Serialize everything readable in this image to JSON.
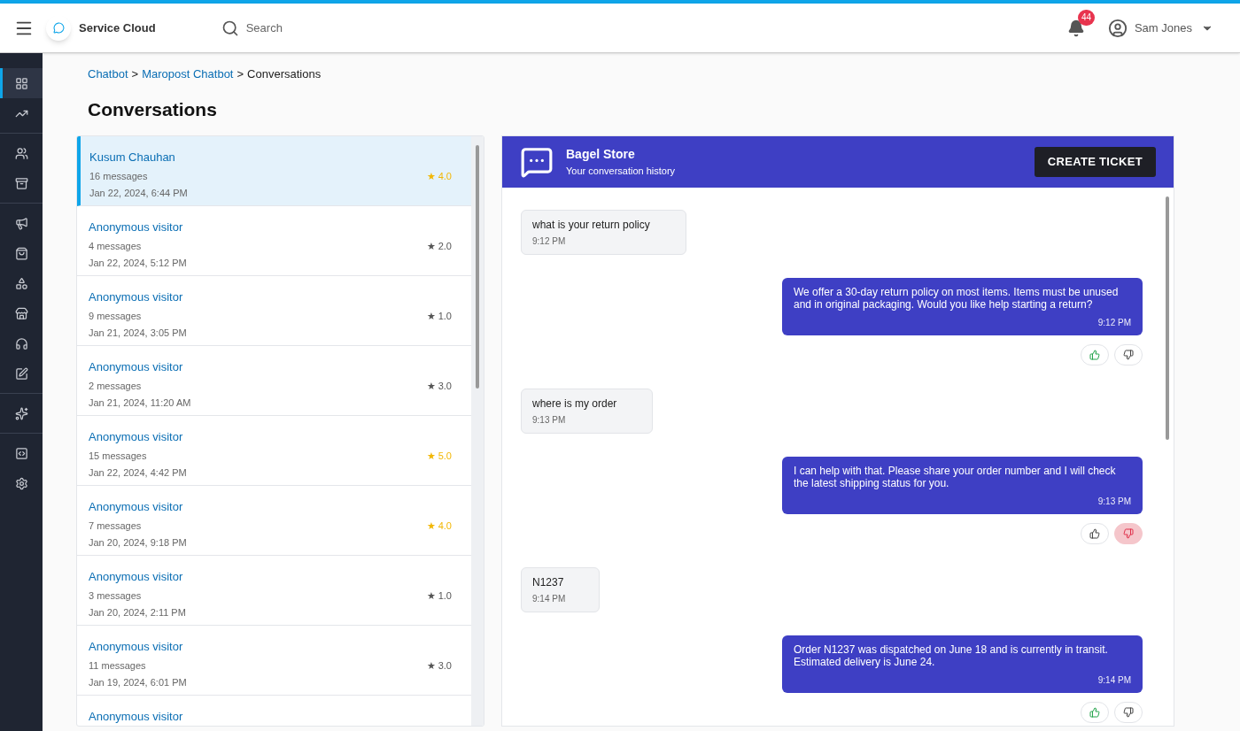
{
  "topbar": {
    "app_name": "Service Cloud",
    "search": {
      "placeholder": "Search"
    },
    "notifications": {
      "count": "44"
    },
    "user": {
      "name": "Sam Jones"
    }
  },
  "sidebar": {
    "groups": [
      [
        {
          "selected": true
        },
        {
          "selected": false
        }
      ],
      [
        {
          "selected": false
        },
        {
          "selected": false
        }
      ],
      [
        {
          "selected": false
        },
        {
          "selected": false
        },
        {
          "selected": false
        },
        {
          "selected": false
        },
        {
          "selected": false
        },
        {
          "selected": false
        }
      ],
      [
        {
          "selected": false
        }
      ],
      [
        {
          "selected": false
        },
        {
          "selected": false
        }
      ]
    ]
  },
  "breadcrumb": {
    "links": [
      "Chatbot",
      "Maropost Chatbot"
    ],
    "separators": [
      ">",
      ">"
    ],
    "current": "Conversations"
  },
  "page_title": "Conversations",
  "conversations": [
    {
      "name": "Kusum Chauhan",
      "messages": "16 messages",
      "date": "Jan 22, 2024, 6:44 PM",
      "rating": "★ 4.0",
      "color": "#f2b705",
      "selected": true
    },
    {
      "name": "Anonymous visitor",
      "messages": "4 messages",
      "date": "Jan 22, 2024, 5:12 PM",
      "rating": "★ 2.0",
      "color": "#555555",
      "selected": false
    },
    {
      "name": "Anonymous visitor",
      "messages": "9 messages",
      "date": "Jan 21, 2024, 3:05 PM",
      "rating": "★ 1.0",
      "color": "#555555",
      "selected": false
    },
    {
      "name": "Anonymous visitor",
      "messages": "2 messages",
      "date": "Jan 21, 2024, 11:20 AM",
      "rating": "★ 3.0",
      "color": "#555555",
      "selected": false
    },
    {
      "name": "Anonymous visitor",
      "messages": "15 messages",
      "date": "Jan 22, 2024, 4:42 PM",
      "rating": "★ 5.0",
      "color": "#f2b705",
      "selected": false
    },
    {
      "name": "Anonymous visitor",
      "messages": "7 messages",
      "date": "Jan 20, 2024, 9:18 PM",
      "rating": "★ 4.0",
      "color": "#f2b705",
      "selected": false
    },
    {
      "name": "Anonymous visitor",
      "messages": "3 messages",
      "date": "Jan 20, 2024, 2:11 PM",
      "rating": "★ 1.0",
      "color": "#555555",
      "selected": false
    },
    {
      "name": "Anonymous visitor",
      "messages": "11 messages",
      "date": "Jan 19, 2024, 6:01 PM",
      "rating": "★ 3.0",
      "color": "#555555",
      "selected": false
    },
    {
      "name": "Anonymous visitor",
      "selected": false
    }
  ],
  "chat": {
    "title": "Bagel Store",
    "subtitle": "Your conversation history",
    "action": "CREATE TICKET",
    "messages": [
      {
        "kind": "user",
        "text": "what is your return policy",
        "time": "9:12 PM"
      },
      {
        "kind": "bot",
        "text": "We offer a 30-day return policy on most items. Items must be unused and in original packaging. Would you like help starting a return?",
        "time": "9:12 PM",
        "liked": true,
        "disliked": false
      },
      {
        "kind": "user",
        "text": "where is my order",
        "time": "9:13 PM"
      },
      {
        "kind": "bot",
        "text": "I can help with that. Please share your order number and I will check the latest shipping status for you.",
        "time": "9:13 PM",
        "liked": false,
        "disliked": true
      },
      {
        "kind": "user",
        "text": "N1237",
        "time": "9:14 PM"
      },
      {
        "kind": "bot",
        "text": "Order N1237 was dispatched on June 18 and is currently in transit. Estimated delivery is June 24.",
        "time": "9:14 PM",
        "liked": true,
        "disliked": false
      }
    ]
  }
}
